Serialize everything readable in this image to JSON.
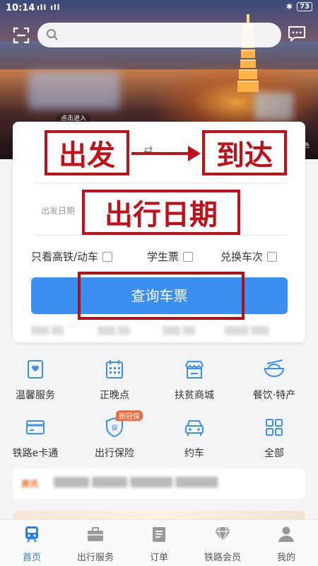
{
  "status_bar": {
    "time": "10:14",
    "signal": "ıll ıll",
    "battery": "73"
  },
  "hero": {
    "enter_label": "点击进入",
    "ad_label": "广告"
  },
  "search": {
    "placeholder": ""
  },
  "ticket": {
    "from_label": "出发",
    "to_label": "到达",
    "date_field_label": "出发日期",
    "date_annotation": "出行日期",
    "options": [
      {
        "label": "只看高铁/动车",
        "checked": false
      },
      {
        "label": "学生票",
        "checked": false
      },
      {
        "label": "兑换车次",
        "checked": false
      }
    ],
    "query_button": "查询车票"
  },
  "services": [
    {
      "label": "温馨服务",
      "icon": "service-icon"
    },
    {
      "label": "正晚点",
      "icon": "calendar-icon"
    },
    {
      "label": "扶贫商城",
      "icon": "shop-icon"
    },
    {
      "label": "餐饮·特产",
      "icon": "food-bowl-icon"
    },
    {
      "label": "铁路e卡通",
      "icon": "card-icon"
    },
    {
      "label": "出行保险",
      "icon": "shield-icon",
      "badge": "新冠保"
    },
    {
      "label": "约车",
      "icon": "car-icon"
    },
    {
      "label": "全部",
      "icon": "grid-icon"
    }
  ],
  "news": {
    "tag": "资讯",
    "text": ""
  },
  "nav": {
    "items": [
      {
        "label": "首页",
        "active": true
      },
      {
        "label": "出行服务",
        "active": false
      },
      {
        "label": "订单",
        "active": false
      },
      {
        "label": "铁路会员",
        "active": false
      },
      {
        "label": "我的",
        "active": false
      }
    ]
  },
  "colors": {
    "accent": "#3b8ff1",
    "annotation_red": "#c0101a",
    "nav_active": "#2a7fe6"
  }
}
